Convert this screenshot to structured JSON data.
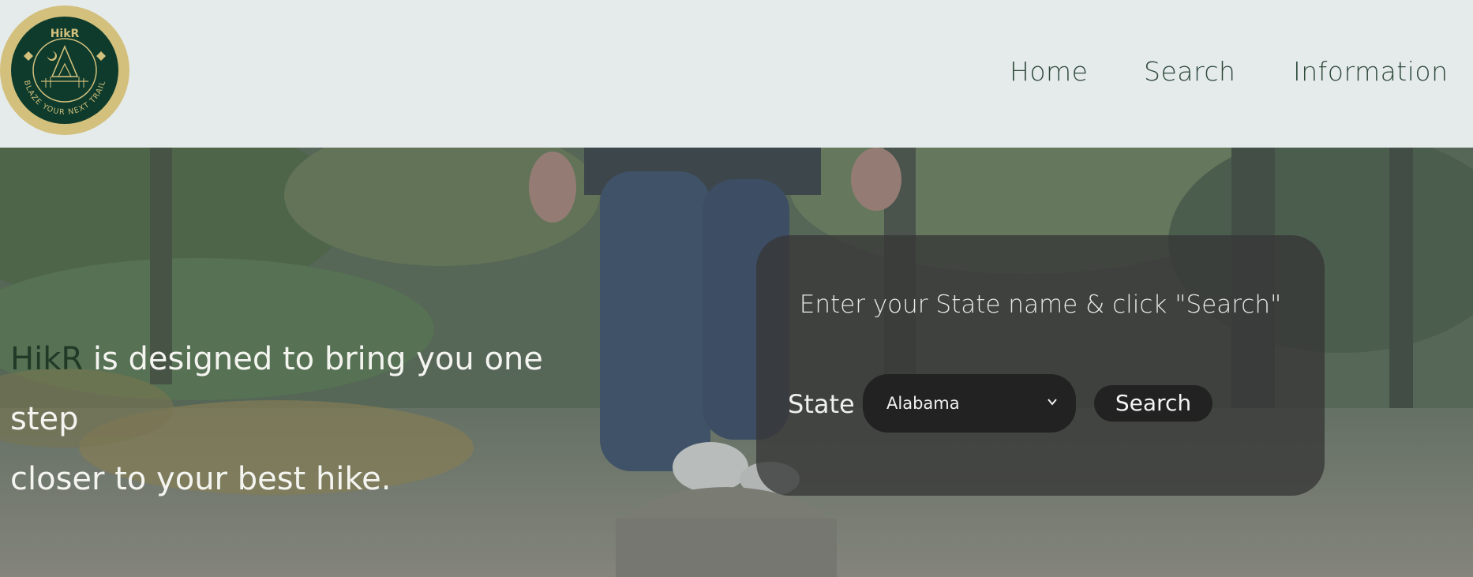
{
  "header": {
    "logo": {
      "brand": "HikR",
      "slogan": "BLAZE YOUR NEXT TRAIL",
      "colors": {
        "ring": "#d2c07c",
        "inner": "#0e3b2c",
        "line": "#d2c07c"
      }
    },
    "nav": [
      {
        "label": "Home"
      },
      {
        "label": "Search"
      },
      {
        "label": "Information"
      }
    ]
  },
  "hero": {
    "tagline": {
      "brand": "HikR",
      "text_line1": " is designed to bring you one step",
      "text_line2": "closer to your best hike."
    },
    "search_card": {
      "instruction": "Enter your State name & click \"Search\"",
      "state_label": "State",
      "state_selected": "Alabama",
      "search_button": "Search"
    },
    "colors": {
      "overlay": "#4a5a55",
      "card": "#373737",
      "brand_text": "#1f3a26"
    }
  }
}
